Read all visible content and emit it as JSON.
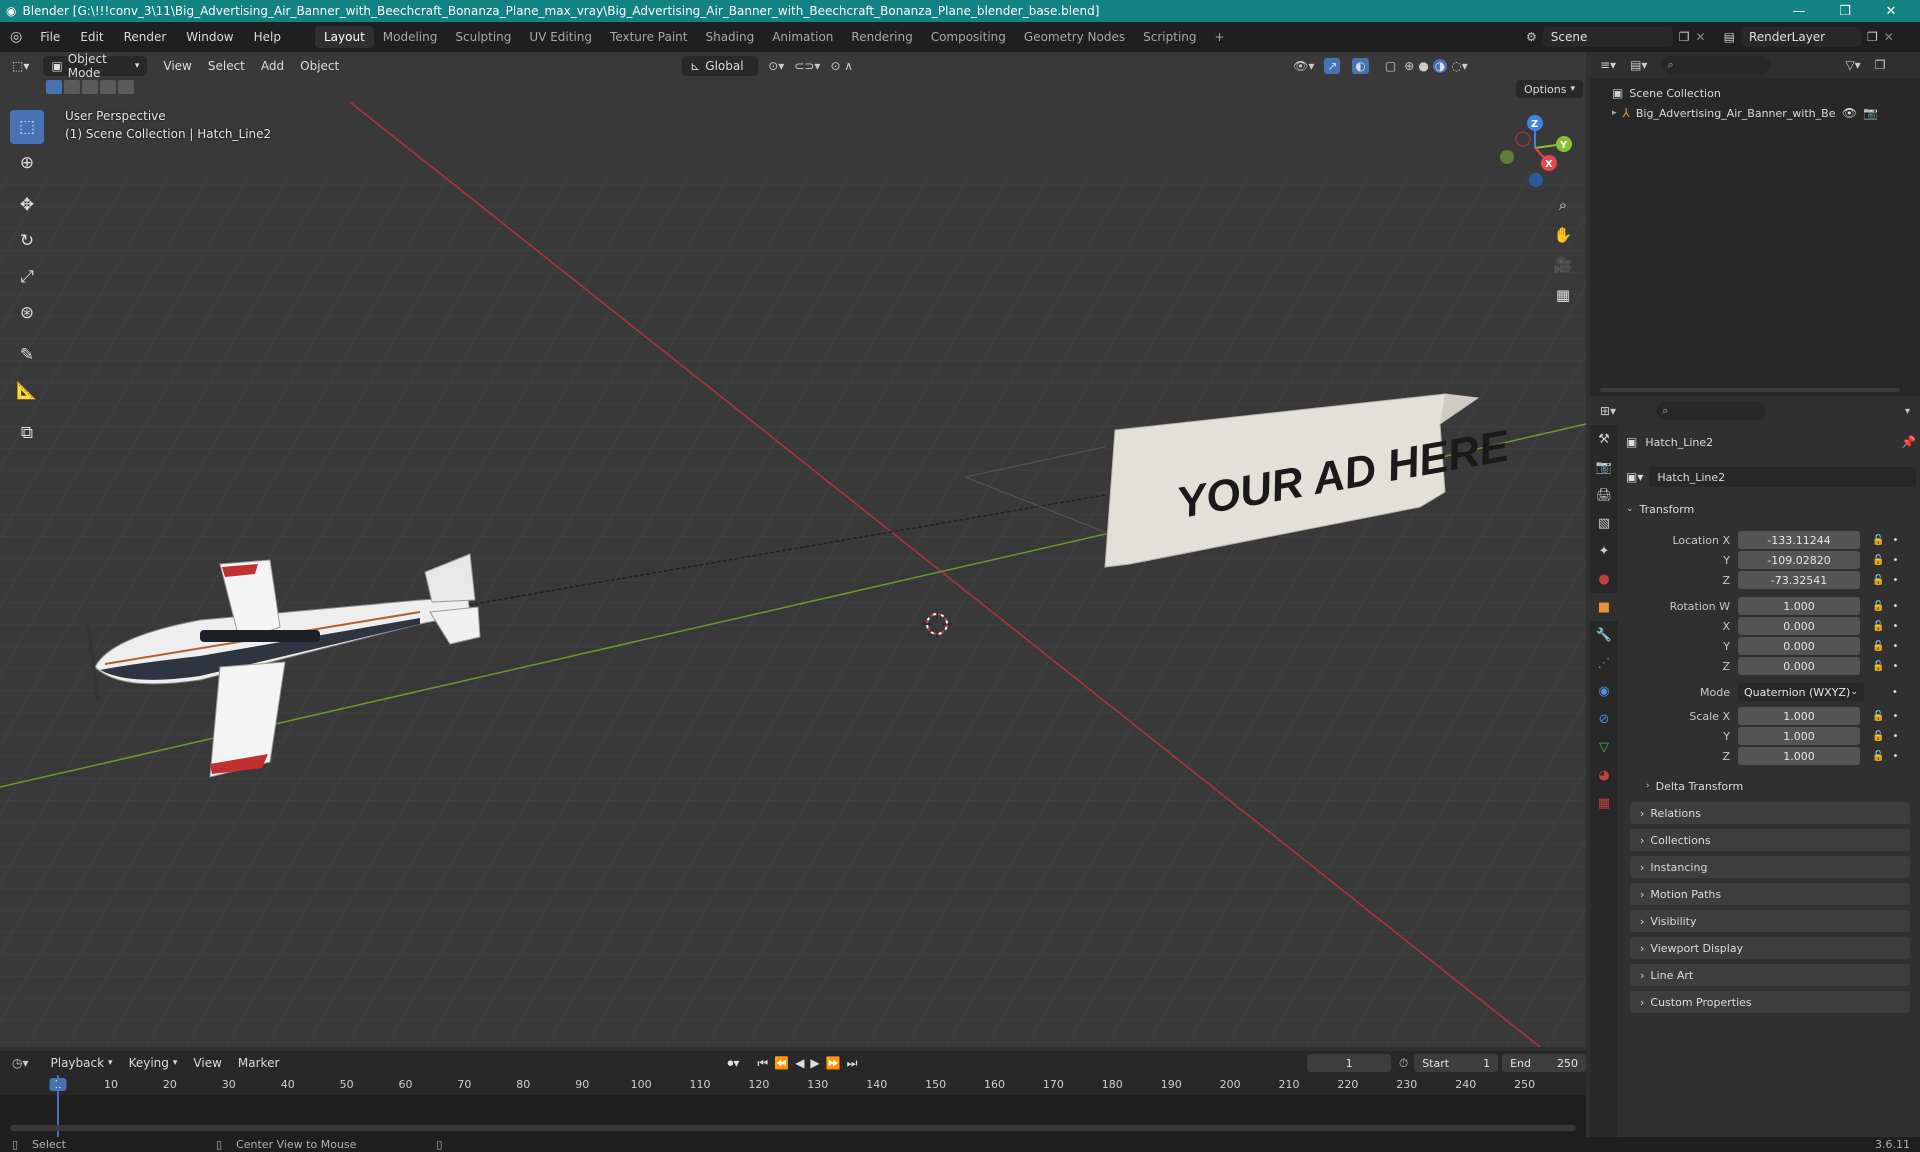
{
  "window": {
    "title": "Blender [G:\\!!!conv_3\\11\\Big_Advertising_Air_Banner_with_Beechcraft_Bonanza_Plane_max_vray\\Big_Advertising_Air_Banner_with_Beechcraft_Bonanza_Plane_blender_base.blend]",
    "minimize": "—",
    "maximize": "❐",
    "close": "✕"
  },
  "menubar": [
    "File",
    "Edit",
    "Render",
    "Window",
    "Help"
  ],
  "workspaces": [
    "Layout",
    "Modeling",
    "Sculpting",
    "UV Editing",
    "Texture Paint",
    "Shading",
    "Animation",
    "Rendering",
    "Compositing",
    "Geometry Nodes",
    "Scripting",
    "+"
  ],
  "active_workspace": "Layout",
  "scene": {
    "name": "Scene",
    "render_layer": "RenderLayer"
  },
  "viewport": {
    "mode": "Object Mode",
    "menus": [
      "View",
      "Select",
      "Add",
      "Object"
    ],
    "orientation": "Global",
    "options": "Options",
    "perspective_label": "User Perspective",
    "collection_label": "(1) Scene Collection | Hatch_Line2",
    "gizmo_axes": {
      "x": "X",
      "y": "Y",
      "z": "Z"
    },
    "banner_text": "YOUR AD HERE"
  },
  "outliner": {
    "root": "Scene Collection",
    "items": [
      {
        "label": "Big_Advertising_Air_Banner_with_Beech"
      }
    ]
  },
  "properties": {
    "object_name": "Hatch_Line2",
    "data_name": "Hatch_Line2",
    "transform_label": "Transform",
    "location": {
      "label": "Location X",
      "x": "-133.11244",
      "y": "-109.02820",
      "z": "-73.32541"
    },
    "rotation": {
      "label": "Rotation W",
      "w": "1.000",
      "x": "0.000",
      "y": "0.000",
      "z": "0.000"
    },
    "mode": {
      "label": "Mode",
      "value": "Quaternion (WXYZ)"
    },
    "scale": {
      "label": "Scale X",
      "x": "1.000",
      "y": "1.000",
      "z": "1.000"
    },
    "axis_labels": {
      "y": "Y",
      "z": "Z",
      "x": "X"
    },
    "delta": "Delta Transform",
    "sections": [
      "Relations",
      "Collections",
      "Instancing",
      "Motion Paths",
      "Visibility",
      "Viewport Display",
      "Line Art",
      "Custom Properties"
    ]
  },
  "timeline": {
    "menus": [
      "Playback",
      "Keying",
      "View",
      "Marker"
    ],
    "current_frame": "1",
    "start_label": "Start",
    "start": "1",
    "end_label": "End",
    "end": "250",
    "ruler": [
      "1",
      "10",
      "20",
      "30",
      "40",
      "50",
      "60",
      "70",
      "80",
      "90",
      "100",
      "110",
      "120",
      "130",
      "140",
      "150",
      "160",
      "170",
      "180",
      "190",
      "200",
      "210",
      "220",
      "230",
      "240",
      "250"
    ]
  },
  "statusbar": {
    "select": "Select",
    "center": "Center View to Mouse",
    "version": "3.6.11"
  },
  "colors": {
    "title_bg": "#128282",
    "accent": "#4772b3",
    "x_axis": "#b2333f",
    "y_axis": "#6b9a2c"
  }
}
